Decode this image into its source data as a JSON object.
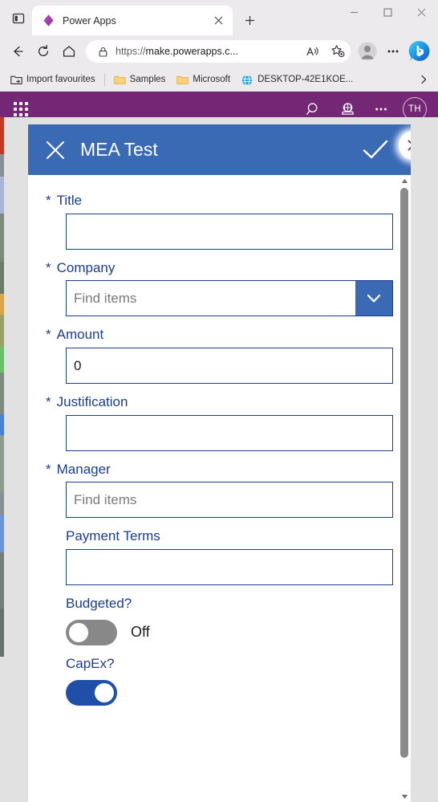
{
  "browser": {
    "tab_search_icon": "tab-list-icon",
    "tab": {
      "favicon": "power-apps-diamond-icon",
      "title": "Power Apps",
      "close_icon": "close-icon"
    },
    "new_tab_label": "+",
    "window_controls": {
      "minimize": "minimize-icon",
      "maximize": "maximize-icon",
      "close": "close-icon"
    },
    "toolbar": {
      "back_icon": "back-arrow-icon",
      "refresh_icon": "refresh-icon",
      "home_icon": "home-icon",
      "lock_icon": "lock-icon",
      "url_scheme": "https://",
      "url_host": "make.powerapps.c...",
      "url_full": "https://make.powerapps.c...",
      "read_aloud_icon": "read-aloud-icon",
      "favorites_icon": "add-favorite-star-icon",
      "profile_icon": "profile-avatar-icon",
      "settings_icon": "ellipsis-icon",
      "copilot_icon": "bing-copilot-icon"
    },
    "bookmarks": {
      "import_label": "Import favourites",
      "import_icon": "import-favourites-icon",
      "items": [
        {
          "label": "Samples",
          "icon": "folder-icon"
        },
        {
          "label": "Microsoft",
          "icon": "folder-icon"
        },
        {
          "label": "DESKTOP-42E1KOE...",
          "icon": "globe-icon"
        }
      ],
      "overflow_icon": "chevron-right-icon"
    }
  },
  "powerapps_nav": {
    "waffle_icon": "app-launcher-waffle-icon",
    "search_icon": "search-icon",
    "environment_icon": "environment-globe-icon",
    "more_icon": "ellipsis-icon",
    "avatar_initials": "TH",
    "bar_color": "#742774"
  },
  "form": {
    "header": {
      "cancel_icon": "close-x-icon",
      "title": "MEA Test",
      "submit_icon": "checkmark-icon",
      "bar_color": "#3b6ab5"
    },
    "close_bubble_icon": "close-icon",
    "scrollbar": {
      "up_arrow_icon": "scroll-up-arrow-icon",
      "down_arrow_icon": "scroll-down-arrow-icon"
    },
    "fields": [
      {
        "label": "Title",
        "required": true,
        "required_marker": "*",
        "type": "text",
        "value": "",
        "placeholder": ""
      },
      {
        "label": "Company",
        "required": true,
        "required_marker": "*",
        "type": "combobox",
        "value": "",
        "placeholder": "Find items",
        "dropdown_icon": "chevron-down-icon"
      },
      {
        "label": "Amount",
        "required": true,
        "required_marker": "*",
        "type": "number",
        "value": "0",
        "placeholder": ""
      },
      {
        "label": "Justification",
        "required": true,
        "required_marker": "*",
        "type": "text",
        "value": "",
        "placeholder": ""
      },
      {
        "label": "Manager",
        "required": true,
        "required_marker": "*",
        "type": "people-picker",
        "value": "",
        "placeholder": "Find items"
      },
      {
        "label": "Payment Terms",
        "required": false,
        "required_marker": "",
        "type": "text",
        "value": "",
        "placeholder": ""
      },
      {
        "label": "Budgeted?",
        "required": false,
        "required_marker": "",
        "type": "toggle",
        "state": "off",
        "state_label": "Off"
      },
      {
        "label": "CapEx?",
        "required": false,
        "required_marker": "",
        "type": "toggle",
        "state": "on",
        "state_label": ""
      }
    ],
    "label_color": "#1c3c91",
    "border_color": "#1c3c91",
    "toggle_off_color": "#888888",
    "toggle_on_color": "#1f4fa8"
  }
}
